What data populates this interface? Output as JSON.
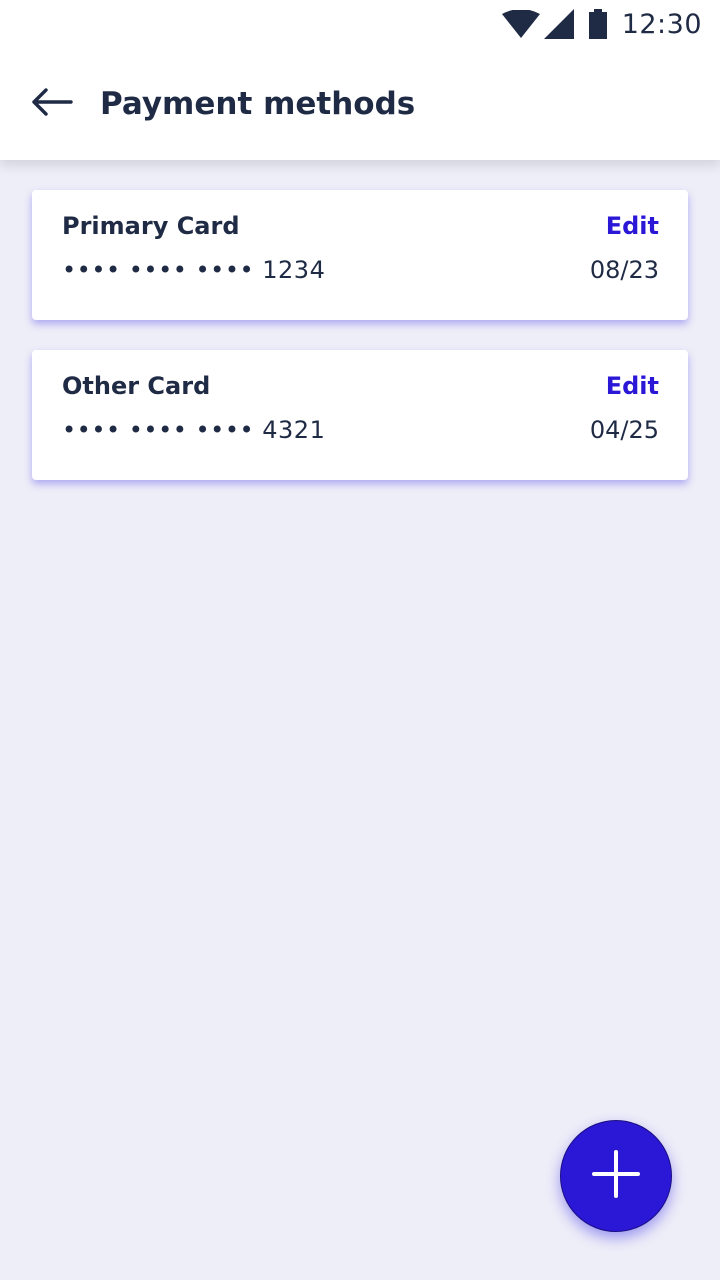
{
  "status_bar": {
    "time": "12:30",
    "icons": [
      "wifi-icon",
      "signal-icon",
      "battery-icon"
    ]
  },
  "app_bar": {
    "back_icon": "arrow-left-icon",
    "title": "Payment methods"
  },
  "cards": [
    {
      "name": "Primary Card",
      "edit_label": "Edit",
      "number": "•••• •••• •••• 1234",
      "expiry": "08/23"
    },
    {
      "name": "Other Card",
      "edit_label": "Edit",
      "number": "•••• •••• •••• 4321",
      "expiry": "04/25"
    }
  ],
  "fab": {
    "icon": "plus-icon"
  },
  "colors": {
    "accent": "#2B17D6",
    "text": "#1F2A44",
    "background": "#EEEEF8",
    "surface": "#FFFFFF"
  }
}
